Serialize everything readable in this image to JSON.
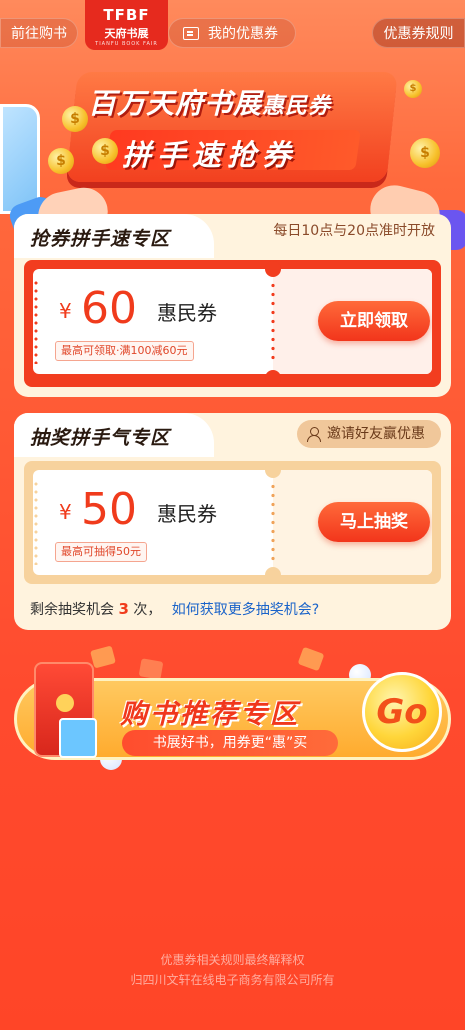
{
  "nav": {
    "back_label": "前往购书",
    "logo_text": "TFBF",
    "logo_sub": "天府书展",
    "logo_tiny": "TIANFU BOOK FAIR",
    "my_coupons_label": "我的优惠券",
    "rules_label": "优惠券规则"
  },
  "hero": {
    "title": "百万天府书展",
    "title_suffix": "惠民券",
    "subtitle": "拼手速抢券"
  },
  "grab_section": {
    "title": "抢券拼手速专区",
    "schedule_note": "每日10点与20点准时开放",
    "coupon": {
      "currency": "¥",
      "amount": "60",
      "name": "惠民券",
      "limit_text": "最高可领取·满100减60元",
      "button_label": "立即领取"
    }
  },
  "lottery_section": {
    "title": "抽奖拼手气专区",
    "invite_label": "邀请好友赢优惠",
    "coupon": {
      "currency": "¥",
      "amount": "50",
      "name": "惠民券",
      "limit_text": "最高可抽得50元",
      "button_label": "马上抽奖"
    },
    "remaining_prefix": "剩余抽奖机会",
    "remaining_count": "3",
    "remaining_suffix": "次，",
    "more_chances_link": "如何获取更多抽奖机会?"
  },
  "recommend": {
    "title": "购书推荐专区",
    "subtitle": "书展好书，用券更“惠”买",
    "go_label": "Go"
  },
  "footer": {
    "line1": "优惠券相关规则最终解释权",
    "line2": "归四川文轩在线电子商务有限公司所有"
  },
  "colors": {
    "brand_red": "#f23d1f",
    "accent_orange": "#ffab2e",
    "link_blue": "#1a63c9"
  }
}
